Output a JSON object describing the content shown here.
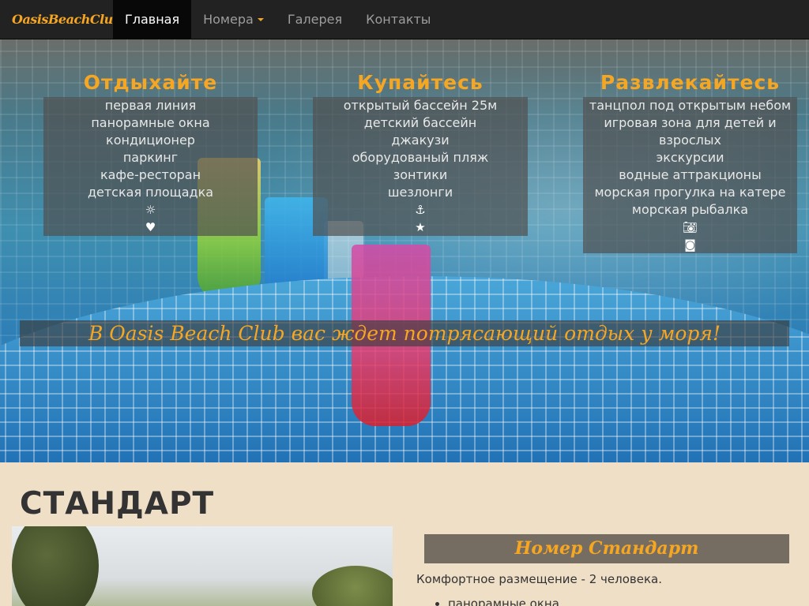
{
  "nav": {
    "brand": "OasisBeachClub",
    "items": [
      {
        "label": "Главная"
      },
      {
        "label": "Номера"
      },
      {
        "label": "Галерея"
      },
      {
        "label": "Контакты"
      }
    ]
  },
  "hero": {
    "panels": [
      {
        "title": "Отдыхайте",
        "items": [
          "первая линия",
          "панорамные окна",
          "кондиционер",
          "паркинг",
          "кафе-ресторан",
          "детская площадка"
        ],
        "icons": [
          "sun-icon",
          "heart-icon"
        ]
      },
      {
        "title": "Купайтесь",
        "items": [
          "открытый бассейн 25м",
          "детский бассейн",
          "джакузи",
          "оборудованый пляж",
          "зонтики",
          "шезлонги"
        ],
        "icons": [
          "anchor-icon",
          "star-icon"
        ]
      },
      {
        "title": "Развлекайтесь",
        "items": [
          "танцпол под открытым небом",
          "игровая зона для детей и",
          "взрослых",
          "экскурсии",
          "водные аттракционы",
          "морская прогулка на катере",
          "морская рыбалка"
        ],
        "icons": [
          "camera-icon",
          "instagram-icon"
        ]
      }
    ],
    "banner": "В Oasis Beach Club вас ждет потрясающий отдых у моря!"
  },
  "room": {
    "section_title": "СТАНДАРТ",
    "card_title": "Номер Стандарт",
    "description": "Комфортное размещение - 2 человека.",
    "features": [
      "панорамные окна"
    ]
  },
  "colors": {
    "accent": "#f5a623",
    "navbar": "#222222",
    "page_bg": "#efdfc7"
  }
}
